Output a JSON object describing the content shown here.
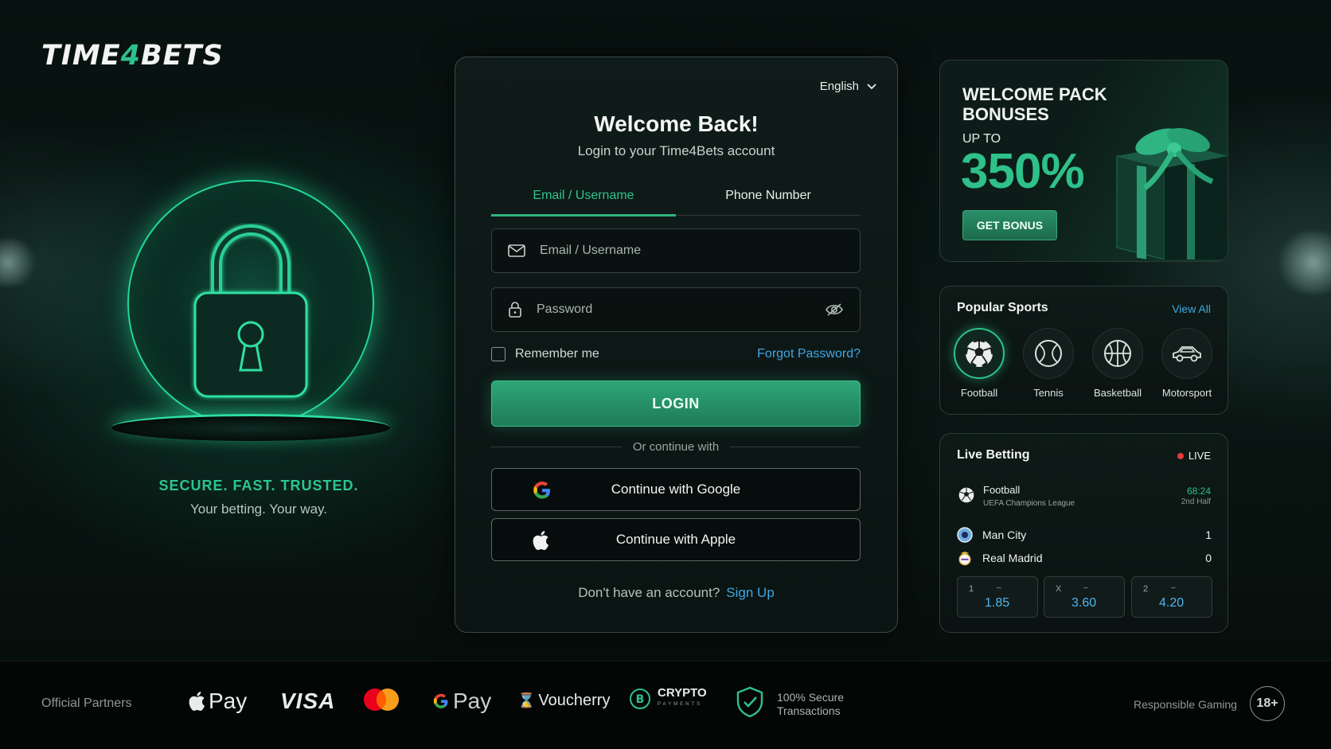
{
  "brand": {
    "logo_part1": "TIME",
    "logo_four": "4",
    "logo_part2": "BETS"
  },
  "hero": {
    "tagline": "SECURE. FAST. TRUSTED.",
    "subtagline": "Your betting. Your way."
  },
  "login": {
    "language": "English",
    "title": "Welcome Back!",
    "subtitle": "Login to your Time4Bets account",
    "tabs": [
      {
        "label": "Email / Username",
        "active": true
      },
      {
        "label": "Phone Number",
        "active": false
      }
    ],
    "email_placeholder": "Email / Username",
    "password_placeholder": "Password",
    "remember_label": "Remember me",
    "forgot_label": "Forgot Password?",
    "login_label": "LOGIN",
    "divider_label": "Or continue with",
    "google_label": "Continue with Google",
    "apple_label": "Continue with Apple",
    "no_account_text": "Don't have an account?",
    "signup_label": "Sign Up"
  },
  "promo": {
    "title": "WELCOME PACK BONUSES",
    "upto": "UP TO",
    "value": "350%",
    "button_label": "GET BONUS"
  },
  "popular_sports": {
    "title": "Popular Sports",
    "view_all": "View All",
    "items": [
      {
        "label": "Football",
        "icon": "football-icon",
        "active": true
      },
      {
        "label": "Tennis",
        "icon": "tennis-icon",
        "active": false
      },
      {
        "label": "Basketball",
        "icon": "basketball-icon",
        "active": false
      },
      {
        "label": "Motorsport",
        "icon": "car-icon",
        "active": false
      }
    ]
  },
  "live_betting": {
    "title": "Live Betting",
    "live_label": "LIVE",
    "sport": "Football",
    "league": "UEFA Champions League",
    "time": "68:24",
    "period": "2nd Half",
    "teams": [
      {
        "name": "Man City",
        "score": "1"
      },
      {
        "name": "Real Madrid",
        "score": "0"
      }
    ],
    "odds": [
      {
        "label": "1",
        "value": "1.85"
      },
      {
        "label": "X",
        "value": "3.60"
      },
      {
        "label": "2",
        "value": "4.20"
      }
    ]
  },
  "footer": {
    "partners_label": "Official Partners",
    "apple_pay": "Pay",
    "visa": "VISA",
    "google_pay": "Pay",
    "voucherry": "Voucherry",
    "crypto": "CRYPTO",
    "crypto_sub": "PAYMENTS",
    "secure_line1": "100% Secure",
    "secure_line2": "Transactions",
    "responsible": "Responsible Gaming",
    "age": "18+"
  },
  "colors": {
    "accent": "#2ec18a",
    "link": "#3fa7e4",
    "live_dot": "#e53b3b"
  }
}
